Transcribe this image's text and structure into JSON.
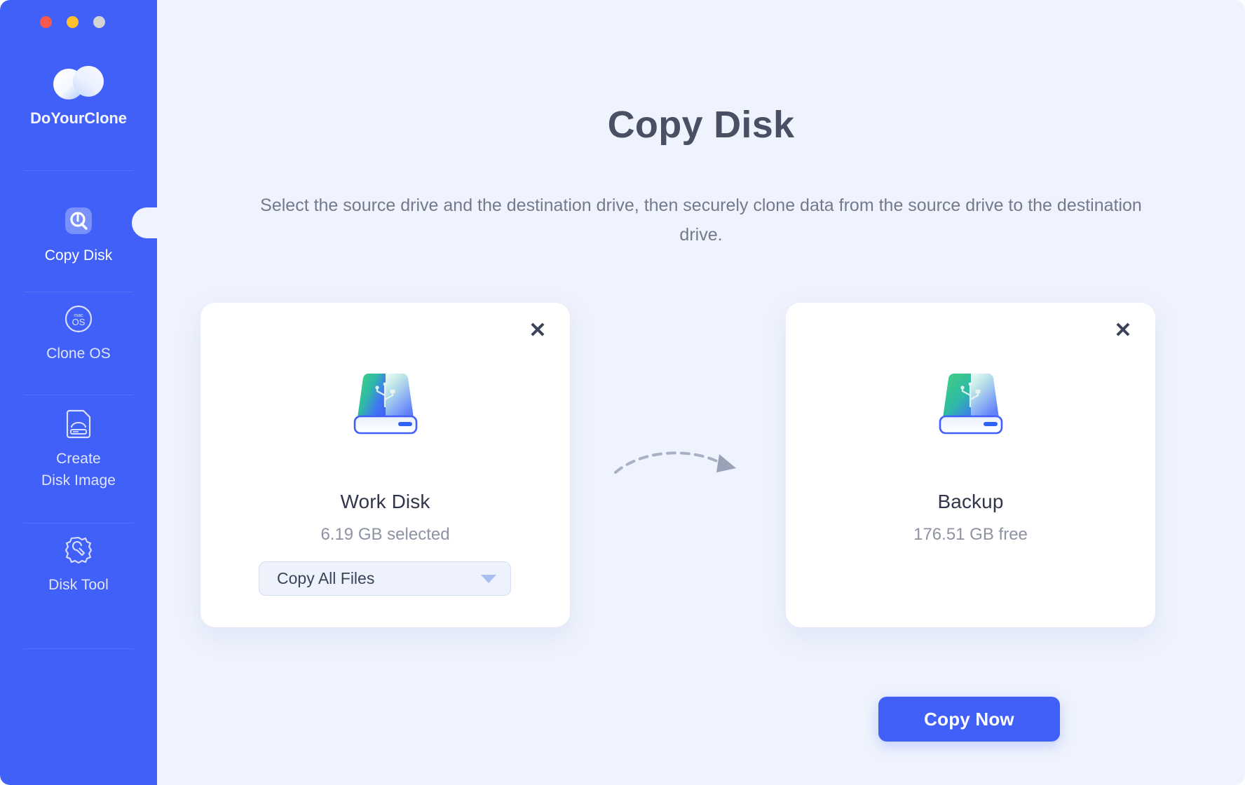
{
  "window": {
    "traffic_lights": [
      {
        "name": "close",
        "color": "#fa584c"
      },
      {
        "name": "minimize",
        "color": "#ffc02e"
      },
      {
        "name": "maximize",
        "color": "#d4d4d4"
      }
    ]
  },
  "sidebar": {
    "brand_name": "DoYourClone",
    "brand_logo_icon": "infinity-loop-logo",
    "background_color": "#4160f8",
    "items": [
      {
        "label": "Copy Disk",
        "icon": "copy-disk-icon",
        "active": true
      },
      {
        "label": "Clone OS",
        "icon": "macos-circle-icon",
        "active": false
      },
      {
        "label": "Create\nDisk Image",
        "label_line1": "Create",
        "label_line2": "Disk Image",
        "icon": "disk-image-document-icon",
        "active": false
      },
      {
        "label": "Disk Tool",
        "icon": "gear-wrench-icon",
        "active": false
      }
    ]
  },
  "main": {
    "title": "Copy Disk",
    "subtitle": "Select the source drive and the destination drive, then securely clone data from the source drive to the destination drive.",
    "background_color": "#eff3fd",
    "source_card": {
      "close_label": "✕",
      "disk_icon": "external-hard-drive-icon",
      "disk_name": "Work Disk",
      "disk_meta": "6.19 GB selected",
      "copy_mode_value": "Copy All Files",
      "copy_mode_caret_icon": "chevron-down-icon"
    },
    "destination_card": {
      "close_label": "✕",
      "disk_icon": "external-hard-drive-icon",
      "disk_name": "Backup",
      "disk_meta": "176.51 GB free"
    },
    "transfer_arrow_icon": "dashed-curved-arrow-right-icon",
    "primary_button": {
      "label": "Copy Now",
      "color": "#4160f8"
    }
  }
}
